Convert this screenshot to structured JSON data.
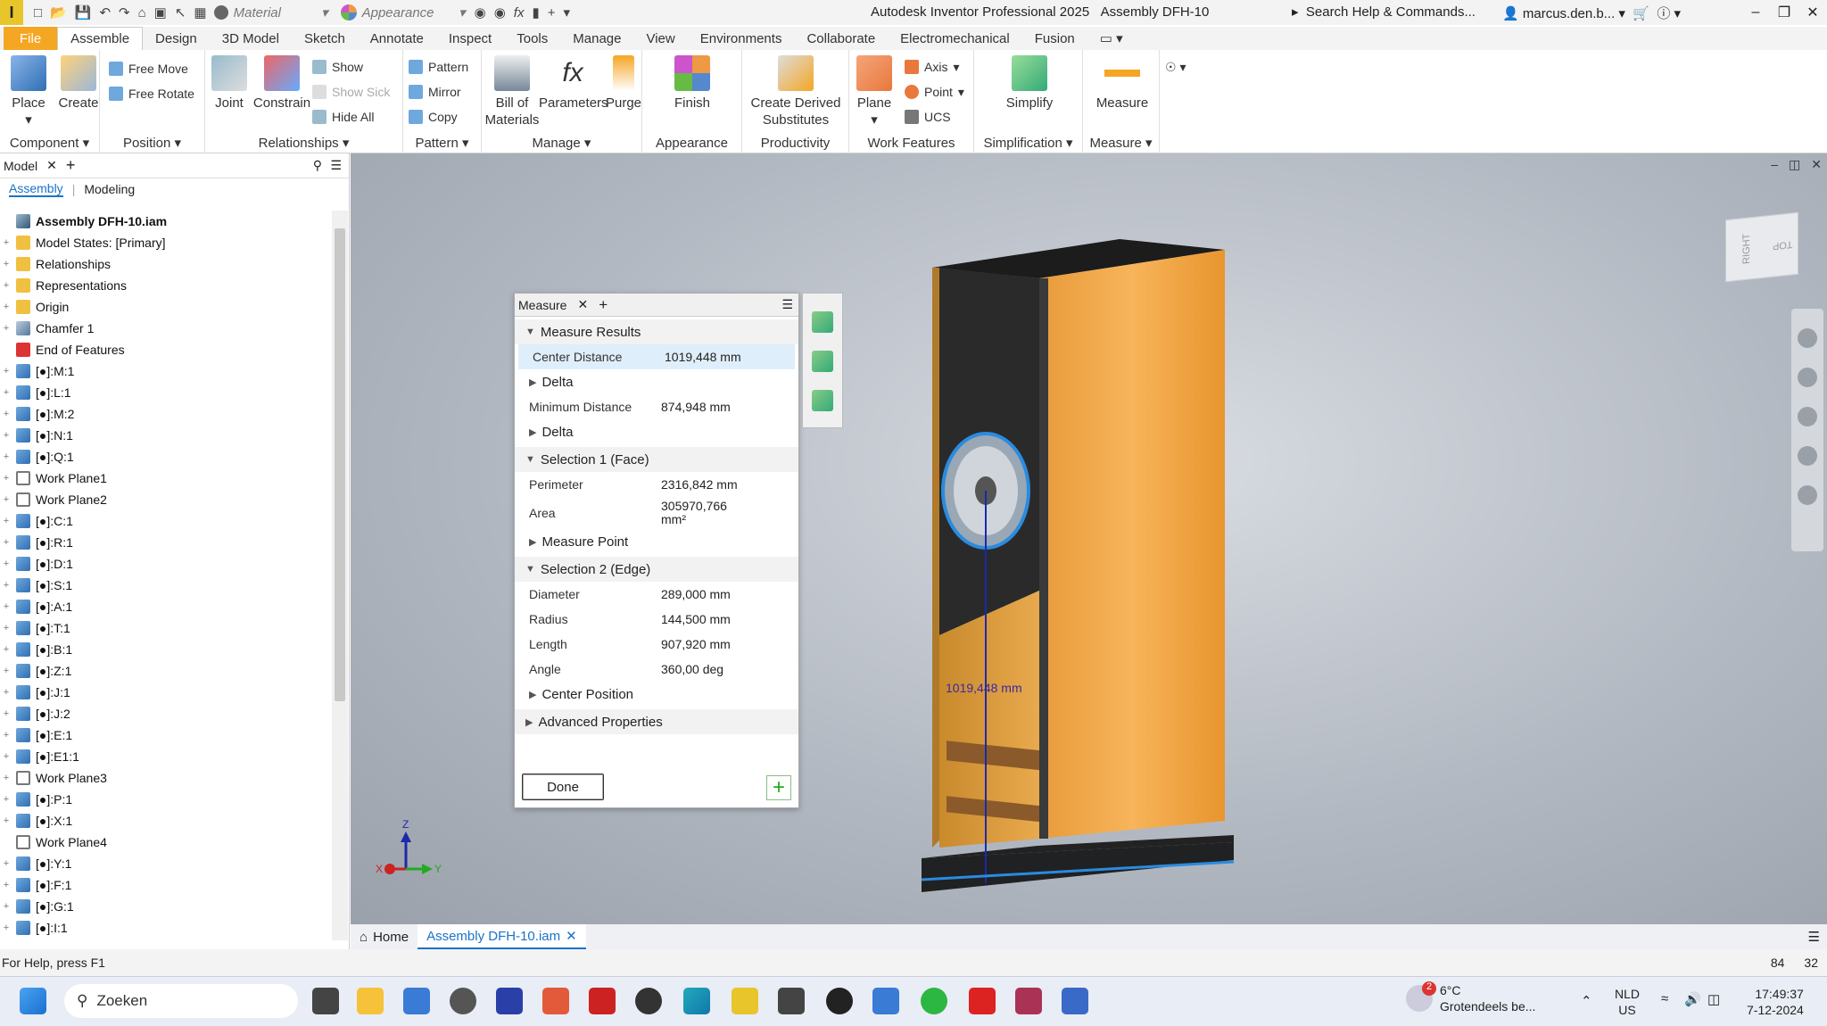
{
  "title_bar": {
    "app_title": "Autodesk Inventor Professional 2025",
    "doc_title": "Assembly DFH-10",
    "search": "Search Help & Commands...",
    "user": "marcus.den.b...",
    "material": "Material",
    "appearance": "Appearance",
    "logo": "I"
  },
  "tabs": [
    "File",
    "Assemble",
    "Design",
    "3D Model",
    "Sketch",
    "Annotate",
    "Inspect",
    "Tools",
    "Manage",
    "View",
    "Environments",
    "Collaborate",
    "Electromechanical",
    "Fusion"
  ],
  "ribbon": {
    "component": {
      "place": "Place",
      "create": "Create",
      "label": "Component"
    },
    "position": {
      "free_move": "Free Move",
      "free_rotate": "Free Rotate",
      "label": "Position"
    },
    "relationships": {
      "joint": "Joint",
      "constrain": "Constrain",
      "show": "Show",
      "show_sick": "Show Sick",
      "hide_all": "Hide All",
      "label": "Relationships"
    },
    "pattern": {
      "pattern": "Pattern",
      "mirror": "Mirror",
      "copy": "Copy",
      "label": "Pattern"
    },
    "manage": {
      "bom": "Bill of Materials",
      "parameters": "Parameters",
      "purge": "Purge",
      "label": "Manage"
    },
    "appearance": {
      "finish": "Finish",
      "label": "Appearance"
    },
    "productivity": {
      "derived": "Create Derived Substitutes",
      "label": "Productivity"
    },
    "work_features": {
      "plane": "Plane",
      "axis": "Axis",
      "point": "Point",
      "ucs": "UCS",
      "label": "Work Features"
    },
    "simplification": {
      "simplify": "Simplify",
      "label": "Simplification"
    },
    "measure": {
      "measure": "Measure",
      "label": "Measure"
    }
  },
  "browser": {
    "tab": "Model",
    "sub_assembly": "Assembly",
    "sub_modeling": "Modeling",
    "nodes": [
      {
        "label": "Assembly DFH-10.iam",
        "icon": "asm",
        "bold": true,
        "exp": ""
      },
      {
        "label": "Model States: [Primary]",
        "icon": "folder",
        "exp": "+"
      },
      {
        "label": "Relationships",
        "icon": "folder",
        "exp": "+"
      },
      {
        "label": "Representations",
        "icon": "folder",
        "exp": "+"
      },
      {
        "label": "Origin",
        "icon": "folder",
        "exp": "+"
      },
      {
        "label": "Chamfer 1",
        "icon": "cham",
        "exp": "+"
      },
      {
        "label": "End of Features",
        "icon": "err",
        "exp": ""
      },
      {
        "label": "[●]:M:1",
        "icon": "part",
        "exp": "+"
      },
      {
        "label": "[●]:L:1",
        "icon": "part",
        "exp": "+"
      },
      {
        "label": "[●]:M:2",
        "icon": "part",
        "exp": "+"
      },
      {
        "label": "[●]:N:1",
        "icon": "part",
        "exp": "+"
      },
      {
        "label": "[●]:Q:1",
        "icon": "part",
        "exp": "+"
      },
      {
        "label": "Work Plane1",
        "icon": "wp",
        "exp": "+"
      },
      {
        "label": "Work Plane2",
        "icon": "wp",
        "exp": "+"
      },
      {
        "label": "[●]:C:1",
        "icon": "part",
        "exp": "+"
      },
      {
        "label": "[●]:R:1",
        "icon": "part",
        "exp": "+"
      },
      {
        "label": "[●]:D:1",
        "icon": "part",
        "exp": "+"
      },
      {
        "label": "[●]:S:1",
        "icon": "part",
        "exp": "+"
      },
      {
        "label": "[●]:A:1",
        "icon": "part",
        "exp": "+"
      },
      {
        "label": "[●]:T:1",
        "icon": "part",
        "exp": "+"
      },
      {
        "label": "[●]:B:1",
        "icon": "part",
        "exp": "+"
      },
      {
        "label": "[●]:Z:1",
        "icon": "part",
        "exp": "+"
      },
      {
        "label": "[●]:J:1",
        "icon": "part",
        "exp": "+"
      },
      {
        "label": "[●]:J:2",
        "icon": "part",
        "exp": "+"
      },
      {
        "label": "[●]:E:1",
        "icon": "part",
        "exp": "+"
      },
      {
        "label": "[●]:E1:1",
        "icon": "part",
        "exp": "+"
      },
      {
        "label": "Work Plane3",
        "icon": "wp",
        "exp": "+"
      },
      {
        "label": "[●]:P:1",
        "icon": "part",
        "exp": "+"
      },
      {
        "label": "[●]:X:1",
        "icon": "part",
        "exp": "+"
      },
      {
        "label": "Work Plane4",
        "icon": "wp",
        "exp": ""
      },
      {
        "label": "[●]:Y:1",
        "icon": "part",
        "exp": "+"
      },
      {
        "label": "[●]:F:1",
        "icon": "part",
        "exp": "+"
      },
      {
        "label": "[●]:G:1",
        "icon": "part",
        "exp": "+"
      },
      {
        "label": "[●]:I:1",
        "icon": "part",
        "exp": "+"
      }
    ]
  },
  "measure": {
    "title": "Measure",
    "results": "Measure Results",
    "center_distance_label": "Center Distance",
    "center_distance": "1019,448 mm",
    "delta": "Delta",
    "min_distance_label": "Minimum Distance",
    "min_distance": "874,948 mm",
    "sel1": "Selection 1 (Face)",
    "perimeter_label": "Perimeter",
    "perimeter": "2316,842 mm",
    "area_label": "Area",
    "area": "305970,766 mm²",
    "measure_point": "Measure Point",
    "sel2": "Selection 2 (Edge)",
    "diameter_label": "Diameter",
    "diameter": "289,000 mm",
    "radius_label": "Radius",
    "radius": "144,500 mm",
    "length_label": "Length",
    "length": "907,920 mm",
    "angle_label": "Angle",
    "angle": "360,00 deg",
    "center_position": "Center Position",
    "advanced": "Advanced Properties",
    "done": "Done"
  },
  "viewport": {
    "dimension_label": "1019,448 mm",
    "cube_right": "RIGHT",
    "cube_top": "TOP",
    "axis_x": "X",
    "axis_y": "Y",
    "axis_z": "Z"
  },
  "doc_tabs": {
    "home": "Home",
    "active": "Assembly DFH-10.iam"
  },
  "status": {
    "help": "For Help, press F1",
    "n1": "84",
    "n2": "32"
  },
  "taskbar": {
    "search": "Zoeken",
    "weather_temp": "6°C",
    "weather_desc": "Grotendeels be...",
    "weather_badge": "2",
    "lang1": "NLD",
    "lang2": "US",
    "time": "17:49:37",
    "date": "7-12-2024"
  }
}
